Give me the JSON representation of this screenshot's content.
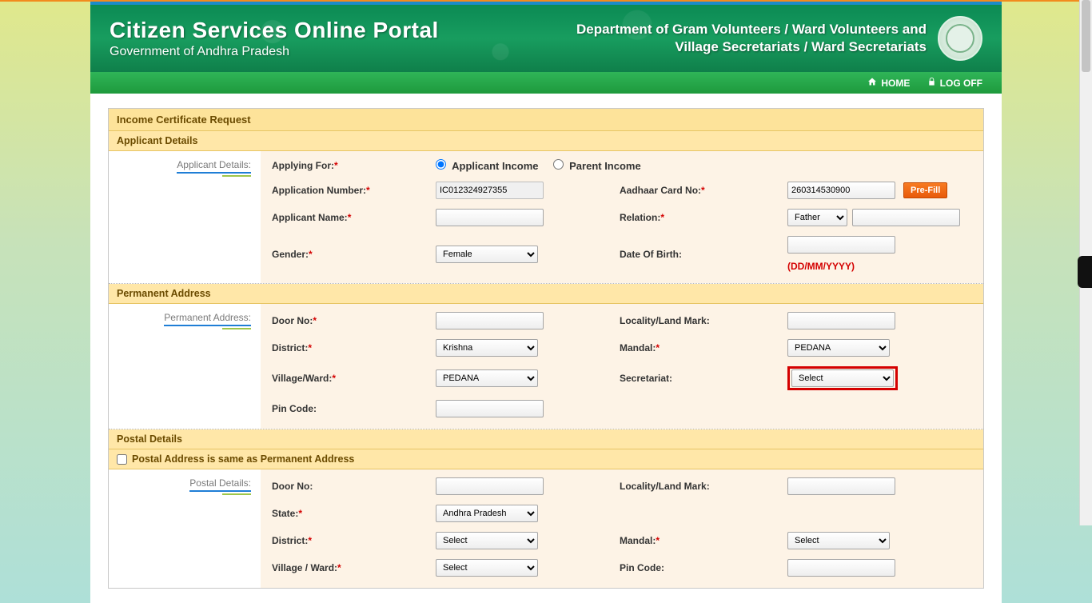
{
  "header": {
    "title": "Citizen Services Online Portal",
    "subtitle": "Government of Andhra Pradesh",
    "dept_line1": "Department of Gram Volunteers / Ward Volunteers and",
    "dept_line2": "Village Secretariats / Ward Secretariats"
  },
  "nav": {
    "home": "HOME",
    "logoff": "LOG OFF"
  },
  "form": {
    "title": "Income Certificate Request",
    "applicant_details": {
      "section_label": "Applicant Details",
      "side_label": "Applicant Details:",
      "applying_for_label": "Applying For:",
      "option_applicant": "Applicant Income",
      "option_parent": "Parent Income",
      "application_number_label": "Application Number:",
      "application_number": "IC012324927355",
      "aadhaar_label": "Aadhaar Card No:",
      "aadhaar": "260314530900",
      "prefill_btn": "Pre-Fill",
      "applicant_name_label": "Applicant Name:",
      "applicant_name": "",
      "relation_label": "Relation:",
      "relation_selected": "Father",
      "relation_name": "",
      "gender_label": "Gender:",
      "gender_selected": "Female",
      "dob_label": "Date Of Birth:",
      "dob": "",
      "dob_hint": "(DD/MM/YYYY)"
    },
    "permanent_address": {
      "section_label": "Permanent Address",
      "side_label": "Permanent Address:",
      "door_label": "Door No:",
      "door": "",
      "locality_label": "Locality/Land Mark:",
      "locality": "",
      "district_label": "District:",
      "district": "Krishna",
      "mandal_label": "Mandal:",
      "mandal": "PEDANA",
      "village_label": "Village/Ward:",
      "village": "PEDANA",
      "secretariat_label": "Secretariat:",
      "secretariat": "Select",
      "pincode_label": "Pin Code:",
      "pincode": ""
    },
    "postal_details": {
      "section_label": "Postal Details",
      "same_as_label": "Postal Address is same as Permanent Address",
      "side_label": "Postal Details:",
      "door_label": "Door No:",
      "door": "",
      "locality_label": "Locality/Land Mark:",
      "locality": "",
      "state_label": "State:",
      "state": "Andhra Pradesh",
      "district_label": "District:",
      "district": "Select",
      "mandal_label": "Mandal:",
      "mandal": "Select",
      "village_label": "Village / Ward:",
      "village": "Select",
      "pincode_label": "Pin Code:",
      "pincode": ""
    }
  }
}
